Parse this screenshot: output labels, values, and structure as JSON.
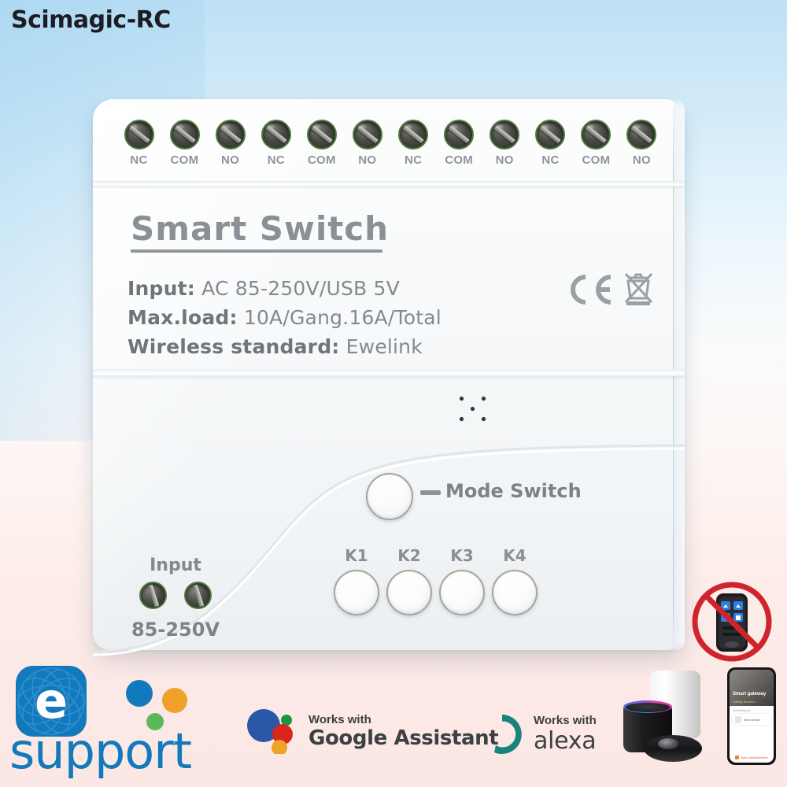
{
  "brand": {
    "name": "Scimagic-RC"
  },
  "device": {
    "product_title": "Smart  Switch",
    "specs": [
      {
        "label": "Input:",
        "value": "AC 85-250V/USB 5V"
      },
      {
        "label": "Max.load:",
        "value": "10A/Gang.16A/Total"
      },
      {
        "label": "Wireless standard:",
        "value": "Ewelink"
      }
    ],
    "terminal_groups": [
      {
        "labels": [
          "NC",
          "COM",
          "NO"
        ]
      },
      {
        "labels": [
          "NC",
          "COM",
          "NO"
        ]
      },
      {
        "labels": [
          "NC",
          "COM",
          "NO"
        ]
      },
      {
        "labels": [
          "NC",
          "COM",
          "NO"
        ]
      }
    ],
    "mode_switch_label": "Mode Switch",
    "channel_buttons": [
      "K1",
      "K2",
      "K3",
      "K4"
    ],
    "input_label": "Input",
    "input_voltage": "85-250V",
    "certification_marks": [
      "ce-mark",
      "weee-crossed-bin-mark"
    ],
    "led_indicator_count": 5
  },
  "badges": {
    "ewelink": {
      "tile_letter": "e",
      "word": "support",
      "color": "#1379bd"
    },
    "google": {
      "works_with": "Works with",
      "name": "Google Assistant"
    },
    "alexa": {
      "works_with": "Works with",
      "name": "alexa",
      "color": "#19847c"
    }
  },
  "no_remote": {
    "meaning": "remote-not-included",
    "ring_color": "#d0242c"
  },
  "companion_devices": {
    "phone_app": {
      "hero_title": "Smart gateway",
      "hero_sub": "Adding devices >",
      "section_label": "Auto/Manual",
      "card_text": "New sensor",
      "footer_text": "Add a smart device"
    }
  }
}
